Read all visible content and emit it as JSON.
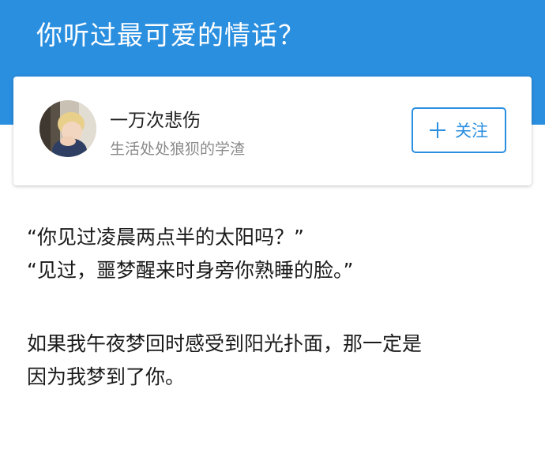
{
  "header": {
    "title": "你听过最可爱的情话？"
  },
  "author": {
    "name": "一万次悲伤",
    "bio": "生活处处狼狈的学渣",
    "avatar_icon": "child-at-window-photo"
  },
  "follow_button": {
    "icon": "plus-icon",
    "label": "关注"
  },
  "content": {
    "paragraphs": [
      [
        "“你见过凌晨两点半的太阳吗？”",
        "“见过，噩梦醒来时身旁你熟睡的脸。”"
      ],
      [
        "如果我午夜梦回时感受到阳光扑面，那一定是",
        "因为我梦到了你。"
      ]
    ]
  },
  "colors": {
    "accent": "#2b8fe0",
    "header_bg": "#2b8fe0",
    "text_primary": "#1a1a1a",
    "text_secondary": "#8a8a8a"
  }
}
